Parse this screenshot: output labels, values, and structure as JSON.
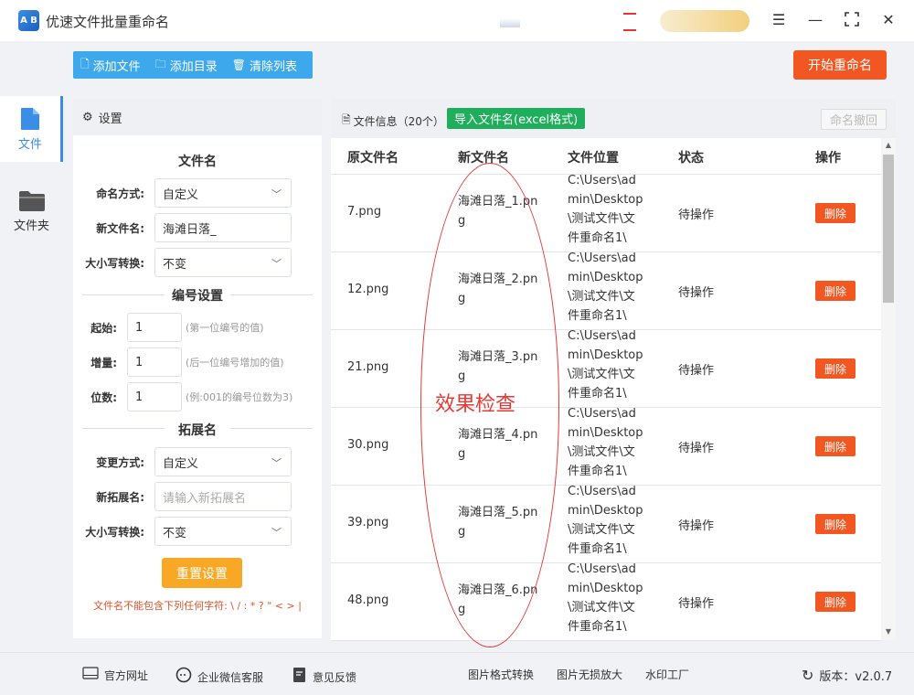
{
  "window": {
    "title": "优速文件批量重命名",
    "logo_text": "A B"
  },
  "nav": [
    {
      "label": "文件"
    },
    {
      "label": "文件夹"
    }
  ],
  "toolbar": {
    "add_file": "添加文件",
    "add_dir": "添加目录",
    "clear_list": "清除列表",
    "start": "开始重命名"
  },
  "settings": {
    "header": "设置",
    "filename_section": "文件名",
    "naming_mode_label": "命名方式:",
    "naming_mode_value": "自定义",
    "new_name_label": "新文件名:",
    "new_name_value": "海滩日落_",
    "case_label": "大小写转换:",
    "case_value": "不变",
    "numbering_section": "编号设置",
    "start_label": "起始:",
    "start_value": "1",
    "start_hint": "(第一位编号的值)",
    "step_label": "增量:",
    "step_value": "1",
    "step_hint": "(后一位编号增加的值)",
    "digits_label": "位数:",
    "digits_value": "1",
    "digits_hint": "(例:001的编号位数为3)",
    "ext_section": "拓展名",
    "ext_mode_label": "变更方式:",
    "ext_mode_value": "自定义",
    "new_ext_label": "新拓展名:",
    "new_ext_placeholder": "请输入新拓展名",
    "ext_case_label": "大小写转换:",
    "ext_case_value": "不变",
    "reset": "重置设置",
    "warning": "文件名不能包含下列任何字符: \\ / : * ? \" < > |"
  },
  "files": {
    "info": "文件信息（20个）",
    "import": "导入文件名(excel格式)",
    "undo": "命名撤回",
    "columns": [
      "原文件名",
      "新文件名",
      "文件位置",
      "状态",
      "操作"
    ],
    "rows": [
      {
        "orig": "7.png",
        "new": "海滩日落_1.png",
        "loc": "C:\\Users\\admin\\Desktop\\测试文件\\文件重命名1\\",
        "status": "待操作",
        "action": "删除"
      },
      {
        "orig": "12.png",
        "new": "海滩日落_2.png",
        "loc": "C:\\Users\\admin\\Desktop\\测试文件\\文件重命名1\\",
        "status": "待操作",
        "action": "删除"
      },
      {
        "orig": "21.png",
        "new": "海滩日落_3.png",
        "loc": "C:\\Users\\admin\\Desktop\\测试文件\\文件重命名1\\",
        "status": "待操作",
        "action": "删除"
      },
      {
        "orig": "30.png",
        "new": "海滩日落_4.png",
        "loc": "C:\\Users\\admin\\Desktop\\测试文件\\文件重命名1\\",
        "status": "待操作",
        "action": "删除"
      },
      {
        "orig": "39.png",
        "new": "海滩日落_5.png",
        "loc": "C:\\Users\\admin\\Desktop\\测试文件\\文件重命名1\\",
        "status": "待操作",
        "action": "删除"
      },
      {
        "orig": "48.png",
        "new": "海滩日落_6.png",
        "loc": "C:\\Users\\admin\\Desktop\\测试文件\\文件重命名1\\",
        "status": "待操作",
        "action": "删除"
      }
    ]
  },
  "annotation": "效果检查",
  "footer": {
    "website": "官方网址",
    "wechat": "企业微信客服",
    "feedback": "意见反馈",
    "img_convert": "图片格式转换",
    "img_enlarge": "图片无损放大",
    "watermark": "水印工厂",
    "version": "版本：v2.0.7"
  },
  "colors": {
    "accent": "#3ea8ed",
    "primary_blue": "#3a8ee6",
    "danger": "#f25621",
    "success": "#1fae5c",
    "warning_btn": "#f9a825",
    "annotation": "#e53935"
  }
}
